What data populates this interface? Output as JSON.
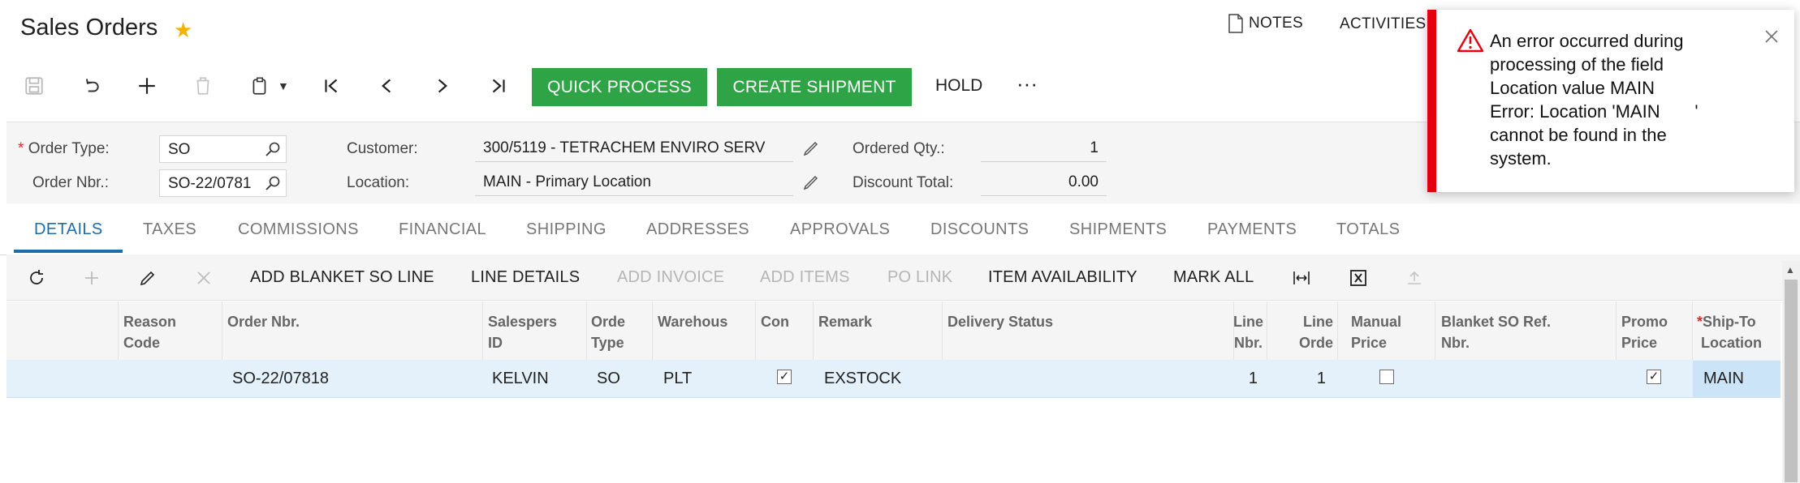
{
  "header": {
    "title": "Sales Orders",
    "top_links": [
      "NOTES",
      "ACTIVITIES"
    ]
  },
  "toolbar": {
    "quick_process": "QUICK PROCESS",
    "create_shipment": "CREATE SHIPMENT",
    "hold": "HOLD",
    "more": "···"
  },
  "form": {
    "order_type_label": "Order Type:",
    "order_type_value": "SO",
    "order_nbr_label": "Order Nbr.:",
    "order_nbr_value": "SO-22/0781",
    "customer_label": "Customer:",
    "customer_value": "300/5119 - TETRACHEM ENVIRO SERV",
    "location_label": "Location:",
    "location_value": "MAIN - Primary Location",
    "ordered_qty_label": "Ordered Qty.:",
    "ordered_qty_value": "1",
    "discount_total_label": "Discount Total:",
    "discount_total_value": "0.00"
  },
  "tabs": [
    "DETAILS",
    "TAXES",
    "COMMISSIONS",
    "FINANCIAL",
    "SHIPPING",
    "ADDRESSES",
    "APPROVALS",
    "DISCOUNTS",
    "SHIPMENTS",
    "PAYMENTS",
    "TOTALS"
  ],
  "grid_toolbar": {
    "add_blanket": "ADD BLANKET SO LINE",
    "line_details": "LINE DETAILS",
    "add_invoice": "ADD INVOICE",
    "add_items": "ADD ITEMS",
    "po_link": "PO LINK",
    "item_availability": "ITEM AVAILABILITY",
    "mark_all": "MARK ALL"
  },
  "grid": {
    "columns": {
      "reason_code": [
        "Reason",
        "Code"
      ],
      "order_nbr": [
        "Order Nbr."
      ],
      "salesperson": [
        "Salespers",
        "ID"
      ],
      "order_type": [
        "Orde",
        "Type"
      ],
      "warehouse": [
        "Warehous"
      ],
      "completed": [
        "Con"
      ],
      "remark": [
        "Remark"
      ],
      "delivery_status": [
        "Delivery Status"
      ],
      "line_nbr": [
        "Line",
        "Nbr."
      ],
      "line_order": [
        "Line",
        "Orde"
      ],
      "manual_price": [
        "Manual",
        "Price"
      ],
      "blanket_ref": [
        "Blanket SO Ref.",
        "Nbr."
      ],
      "promo_price": [
        "Promo",
        "Price"
      ],
      "ship_to_location": [
        "Ship-To",
        "Location"
      ]
    },
    "row": {
      "order_nbr": "SO-22/07818",
      "salesperson": "KELVIN",
      "order_type": "SO",
      "warehouse": "PLT",
      "completed": true,
      "remark": "EXSTOCK",
      "line_nbr": "1",
      "line_order": "1",
      "manual_price": false,
      "promo_price": true,
      "ship_to_location": "MAIN"
    }
  },
  "toast": {
    "message": "An error occurred during\nprocessing of the field\nLocation value MAIN\nError: Location 'MAIN       '\ncannot be found in the\nsystem."
  },
  "colors": {
    "accent_green": "#2ea447",
    "tab_active": "#1e6ca8",
    "error_red": "#e3000f",
    "star": "#f0b400"
  }
}
